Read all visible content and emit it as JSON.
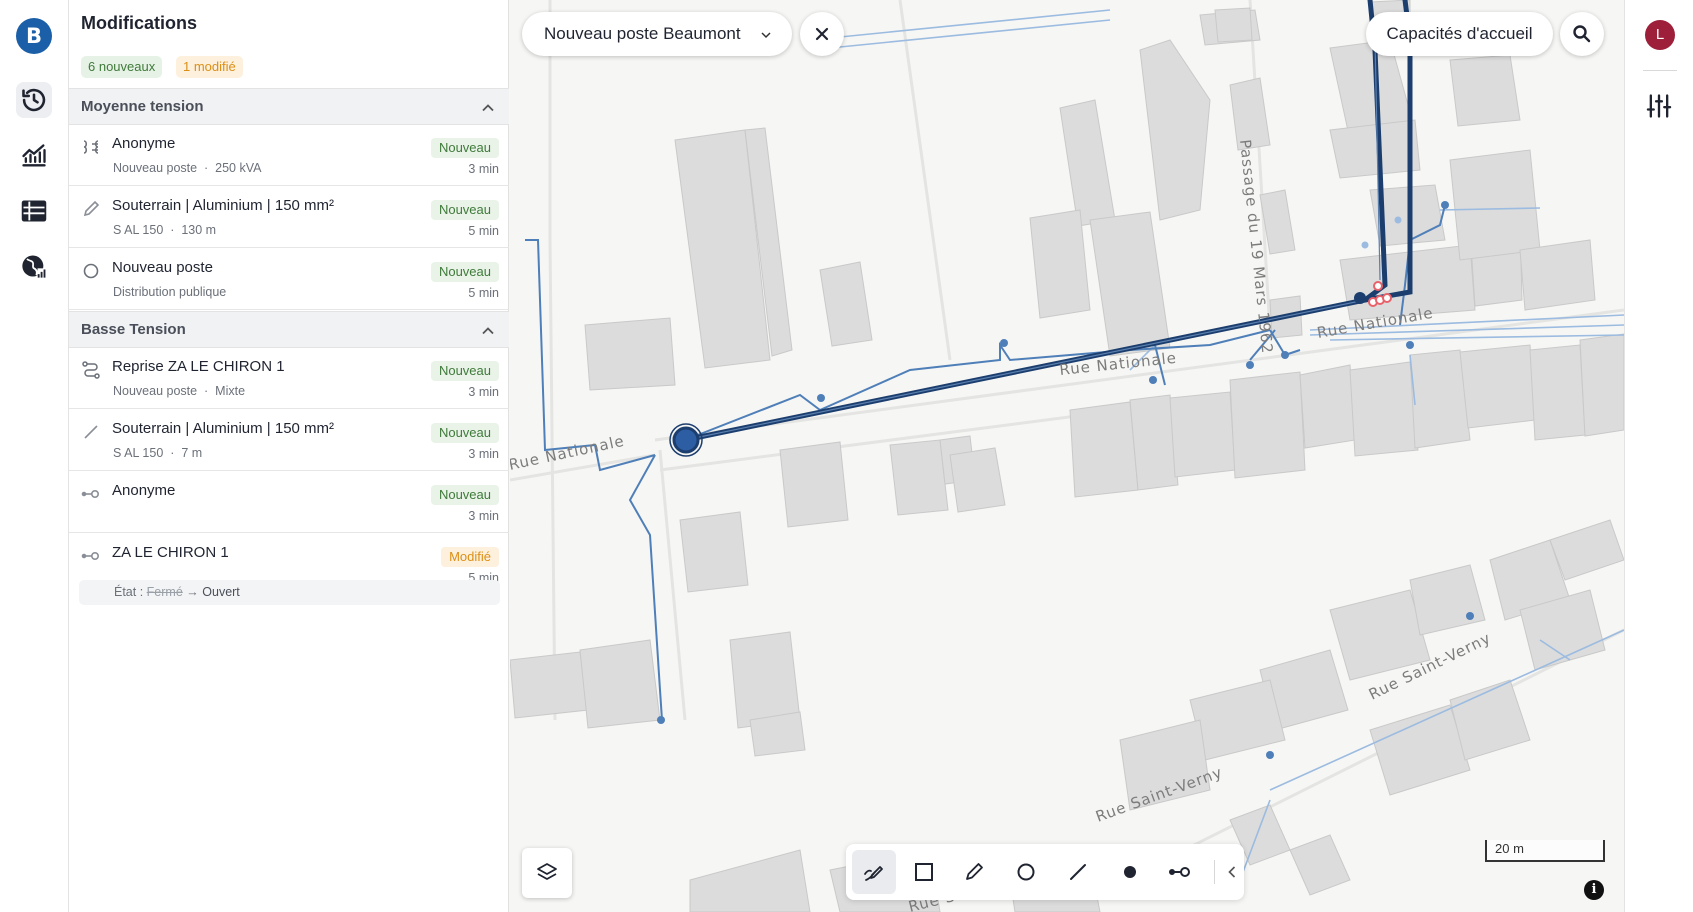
{
  "app": {
    "logo_letter": "B",
    "user_initial": "L"
  },
  "rail": {
    "items": [
      {
        "name": "history",
        "icon": "history-icon",
        "active": true
      },
      {
        "name": "analytics",
        "icon": "chart-icon",
        "active": false
      },
      {
        "name": "table",
        "icon": "table-icon",
        "active": false
      },
      {
        "name": "network",
        "icon": "globe-icon",
        "active": false
      }
    ]
  },
  "panel": {
    "title": "Modifications",
    "badge_new": "6 nouveaux",
    "badge_modified": "1 modifié",
    "sections": [
      {
        "label": "Moyenne tension",
        "rows": [
          {
            "icon": "substation-icon",
            "title": "Anonyme",
            "sub_a": "Nouveau poste",
            "sub_b": "250 kVA",
            "status": "Nouveau",
            "time": "3 min"
          },
          {
            "icon": "pencil-line-icon",
            "title": "Souterrain | Aluminium | 150 mm²",
            "sub_a": "S AL 150",
            "sub_b": "130 m",
            "status": "Nouveau",
            "time": "5 min"
          },
          {
            "icon": "circle-icon",
            "title": "Nouveau poste",
            "sub_a": "Distribution publique",
            "sub_b": "",
            "status": "Nouveau",
            "time": "5 min"
          }
        ]
      },
      {
        "label": "Basse Tension",
        "rows": [
          {
            "icon": "route-icon",
            "title": "Reprise ZA LE CHIRON 1",
            "sub_a": "Nouveau poste",
            "sub_b": "Mixte",
            "status": "Nouveau",
            "time": "3 min"
          },
          {
            "icon": "line-icon",
            "title": "Souterrain | Aluminium | 150 mm²",
            "sub_a": "S AL 150",
            "sub_b": "7 m",
            "status": "Nouveau",
            "time": "3 min"
          },
          {
            "icon": "switch-icon",
            "title": "Anonyme",
            "sub_a": "",
            "sub_b": "",
            "status": "Nouveau",
            "time": "3 min"
          },
          {
            "icon": "switch-icon",
            "title": "ZA LE CHIRON 1",
            "sub_a": "",
            "sub_b": "",
            "status": "Modifié",
            "time": "5 min"
          }
        ]
      }
    ],
    "detail": {
      "label": "État :",
      "old": "Fermé",
      "arrow": "→",
      "new": "Ouvert"
    }
  },
  "map": {
    "project_select": "Nouveau poste Beaumont",
    "capacities_button": "Capacités d'accueil",
    "scale_label": "20 m",
    "info_label": "i",
    "streets": [
      "Rue Nationale",
      "Rue Nationale",
      "Rue Nationale",
      "Passage du 19 Mars 1962",
      "Rue Saint-Verny",
      "Rue Saint-Verny",
      "Rue Saint-Verny"
    ],
    "tools": [
      "draw-route-icon",
      "rectangle-icon",
      "pencil-icon",
      "circle-icon",
      "line-icon",
      "point-icon",
      "switch-icon"
    ],
    "colors": {
      "mv_line": "#1c3e6e",
      "lv_line": "#4f7fb8",
      "lv_light": "#9bbbe0",
      "building": "#dcdcdc",
      "alert": "#e8626b"
    }
  }
}
